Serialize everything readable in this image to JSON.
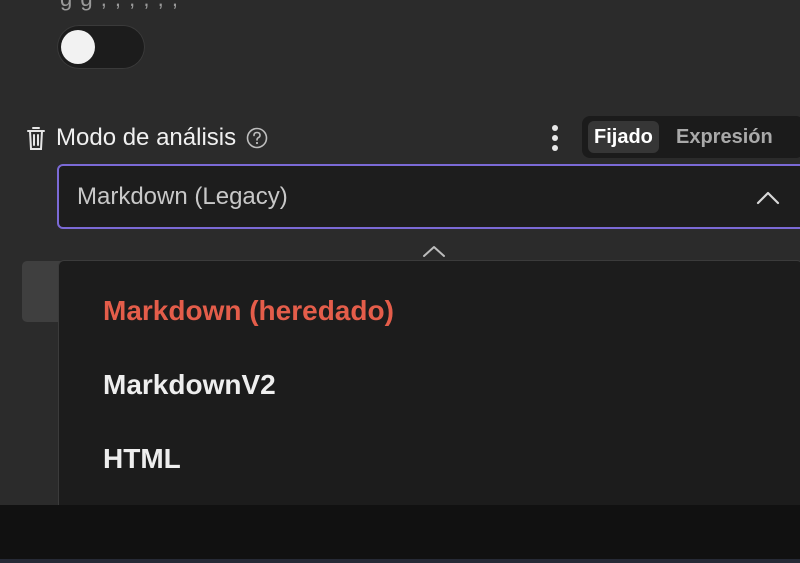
{
  "above": {
    "cut_text": "g  g  ,  ,  ,  ,  ,  ,",
    "toggle_state": "off"
  },
  "field": {
    "label": "Modo de análisis",
    "icons": {
      "delete": "trash-icon",
      "help": "question-circle-icon",
      "more": "kebab-menu-icon"
    }
  },
  "mode_switch": {
    "fixed_label": "Fijado",
    "expression_label": "Expresión",
    "active": "Fijado"
  },
  "select": {
    "value": "Markdown (Legacy)",
    "open": true
  },
  "dropdown": {
    "options": [
      {
        "label": "Markdown (heredado)",
        "selected": true
      },
      {
        "label": "MarkdownV2",
        "selected": false
      },
      {
        "label": "HTML",
        "selected": false
      }
    ]
  },
  "colors": {
    "accent_border": "#7b6ad6",
    "selected_option": "#e45d4a",
    "panel_bg": "#2b2b2b",
    "dropdown_bg": "#1c1c1c"
  }
}
